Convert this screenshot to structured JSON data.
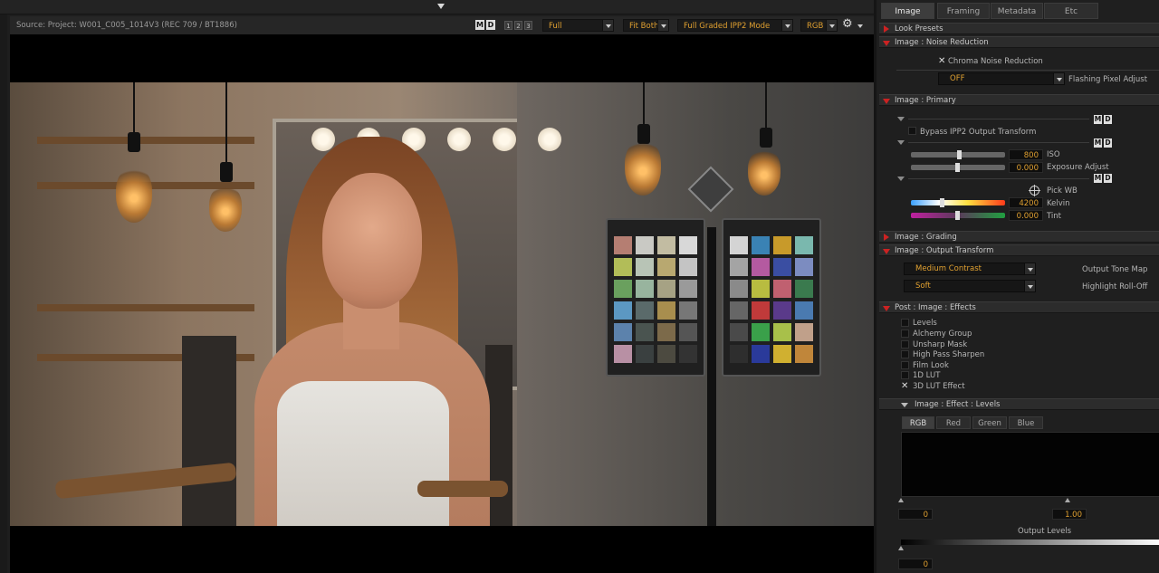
{
  "viewer": {
    "source_label": "Source: Project: W001_C005_1014V3    (REC 709 / BT1886)",
    "md_m": "M",
    "md_d": "D",
    "nums": [
      "1",
      "2",
      "3"
    ],
    "resolution": "Full",
    "fit": "Fit Both",
    "mode": "Full Graded IPP2 Mode",
    "channel": "RGB"
  },
  "tabs": [
    "Image",
    "Framing",
    "Metadata",
    "Etc"
  ],
  "sections": {
    "look_presets": "Look Presets",
    "noise_reduction": "Image : Noise Reduction",
    "primary": "Image : Primary",
    "grading": "Image : Grading",
    "output_transform": "Image : Output Transform",
    "post_effects": "Post : Image : Effects",
    "effect_levels": "Image : Effect : Levels"
  },
  "noise": {
    "chroma_label": "Chroma Noise Reduction",
    "chroma_checked": true,
    "flashing_value": "OFF",
    "flashing_label": "Flashing Pixel Adjust"
  },
  "primary": {
    "md_m": "M",
    "md_d": "D",
    "bypass_label": "Bypass IPP2 Output Transform",
    "iso_value": "800",
    "iso_label": "ISO",
    "exposure_value": "0.000",
    "exposure_label": "Exposure Adjust",
    "pickwb_label": "Pick WB",
    "kelvin_value": "4200",
    "kelvin_label": "Kelvin",
    "tint_value": "0.000",
    "tint_label": "Tint"
  },
  "output_transform": {
    "tone_map_value": "Medium Contrast",
    "tone_map_label": "Output Tone Map",
    "rolloff_value": "Soft",
    "rolloff_label": "Highlight Roll-Off"
  },
  "effects": [
    {
      "label": "Levels",
      "checked": false
    },
    {
      "label": "Alchemy Group",
      "checked": false
    },
    {
      "label": "Unsharp Mask",
      "checked": false
    },
    {
      "label": "High Pass Sharpen",
      "checked": false
    },
    {
      "label": "Film Look",
      "checked": false
    },
    {
      "label": "1D LUT",
      "checked": false
    },
    {
      "label": "3D LUT Effect",
      "checked": true
    }
  ],
  "levels": {
    "channels": [
      "RGB",
      "Red",
      "Green",
      "Blue"
    ],
    "input_black": "0",
    "input_gamma": "1.00",
    "output_label": "Output Levels",
    "output_black": "0"
  },
  "colors": {
    "accent_orange": "#e0a030",
    "section_arrow_red": "#cc2222",
    "kelvin_gradient": [
      "#3aa0ff",
      "#ffffff",
      "#ffe040",
      "#ff3a1a"
    ],
    "tint_gradient": [
      "#c020a0",
      "#20a040"
    ]
  }
}
